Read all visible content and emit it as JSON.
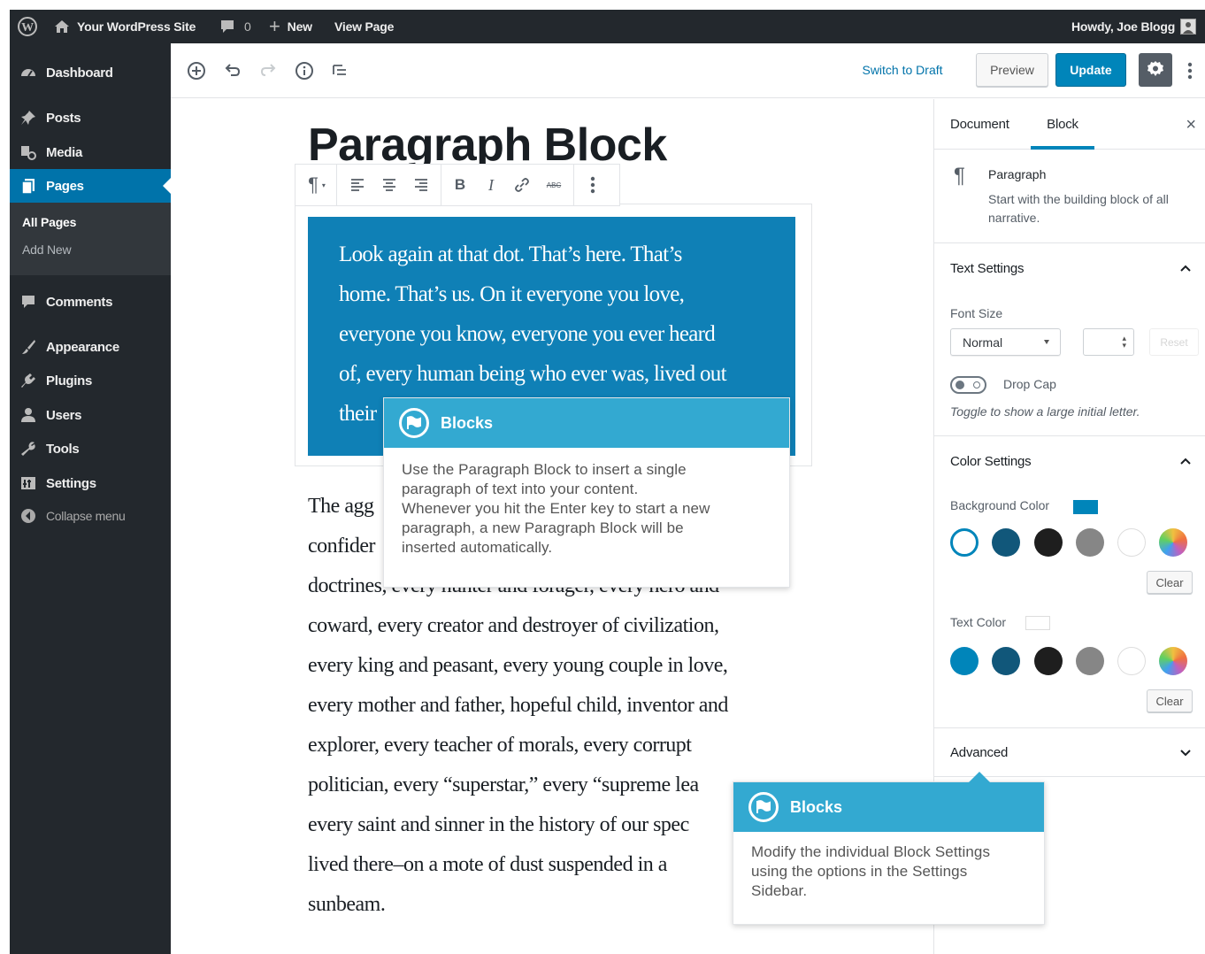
{
  "admin_bar": {
    "site_name": "Your WordPress Site",
    "comments_count": "0",
    "new_label": "New",
    "view_page": "View Page",
    "greeting": "Howdy, Joe Blogg"
  },
  "sidebar_menu": {
    "dashboard": "Dashboard",
    "posts": "Posts",
    "media": "Media",
    "pages": "Pages",
    "all_pages": "All Pages",
    "add_new": "Add New",
    "comments": "Comments",
    "appearance": "Appearance",
    "plugins": "Plugins",
    "users": "Users",
    "tools": "Tools",
    "settings": "Settings",
    "collapse": "Collapse menu"
  },
  "header": {
    "switch_to_draft": "Switch to Draft",
    "preview": "Preview",
    "update": "Update"
  },
  "post": {
    "title": "Paragraph Block",
    "quote_lines": [
      "Look again at that dot. That’s here. That’s",
      "home. That’s us. On it everyone you love,",
      "everyone you know, everyone you ever heard",
      "of, every human being who ever was, lived out",
      "their"
    ],
    "paragraph_lines": [
      "The agg",
      "confider",
      "doctrines, every hunter and forager, every hero and",
      "coward, every creator and destroyer of civilization,",
      "every king and peasant, every young couple in love,",
      "every mother and father, hopeful child, inventor and",
      "explorer, every teacher of morals, every corrupt",
      "politician, every “superstar,” every “supreme lea",
      "every saint and sinner in the history of our spec",
      "lived there–on a mote of dust suspended in a",
      "sunbeam."
    ]
  },
  "tip1": {
    "title": "Blocks",
    "lines": [
      "Use the Paragraph Block to insert a single",
      "paragraph of text into your content.",
      "Whenever you hit the Enter key to start a new",
      "paragraph, a new Paragraph Block will be",
      "inserted automatically."
    ]
  },
  "tip2": {
    "title": "Blocks",
    "lines": [
      "Modify the individual Block Settings",
      "using the options in the Settings",
      "Sidebar."
    ]
  },
  "settings_sidebar": {
    "tab_document": "Document",
    "tab_block": "Block",
    "close": "×",
    "block_name": "Paragraph",
    "block_desc": "Start with the building block of all narrative.",
    "text_settings": "Text Settings",
    "font_size_label": "Font Size",
    "font_size_value": "Normal",
    "reset": "Reset",
    "drop_cap": "Drop Cap",
    "drop_cap_help": "Toggle to show a large initial letter.",
    "color_settings": "Color Settings",
    "background_color": "Background Color",
    "text_color": "Text Color",
    "clear": "Clear",
    "advanced": "Advanced"
  },
  "colors": {
    "admin_dark": "#23282d",
    "accent": "#0073aa",
    "block_bg": "#0f80b6",
    "tip_head": "#33a9d1",
    "palette": [
      "#0085ba",
      "#11577a",
      "#1e1e1e",
      "#868686",
      "#ffffff",
      "gradient"
    ]
  }
}
